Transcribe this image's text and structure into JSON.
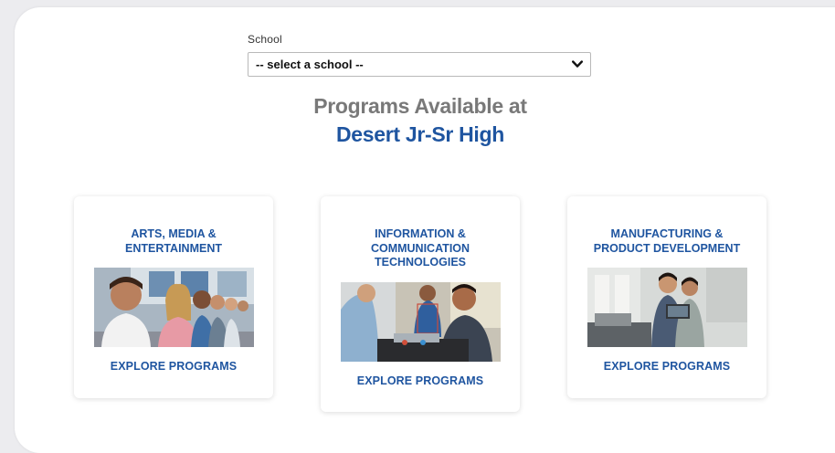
{
  "form": {
    "school_label": "School",
    "school_select": {
      "selected": "-- select a school --",
      "icon": "chevron-down-icon"
    }
  },
  "heading": {
    "line1": "Programs Available at",
    "line2": "Desert Jr-Sr High"
  },
  "colors": {
    "accent_blue": "#1f55a0",
    "heading_gray": "#797979",
    "page_bg": "#ececef",
    "panel_bg": "#ffffff"
  },
  "cards": [
    {
      "title_lines": [
        "ARTS, MEDIA &",
        "ENTERTAINMENT"
      ],
      "cta": "EXPLORE PROGRAMS"
    },
    {
      "title_lines": [
        "INFORMATION &",
        "COMMUNICATION",
        "TECHNOLOGIES"
      ],
      "cta": "EXPLORE PROGRAMS"
    },
    {
      "title_lines": [
        "MANUFACTURING &",
        "PRODUCT DEVELOPMENT"
      ],
      "cta": "EXPLORE PROGRAMS"
    }
  ]
}
